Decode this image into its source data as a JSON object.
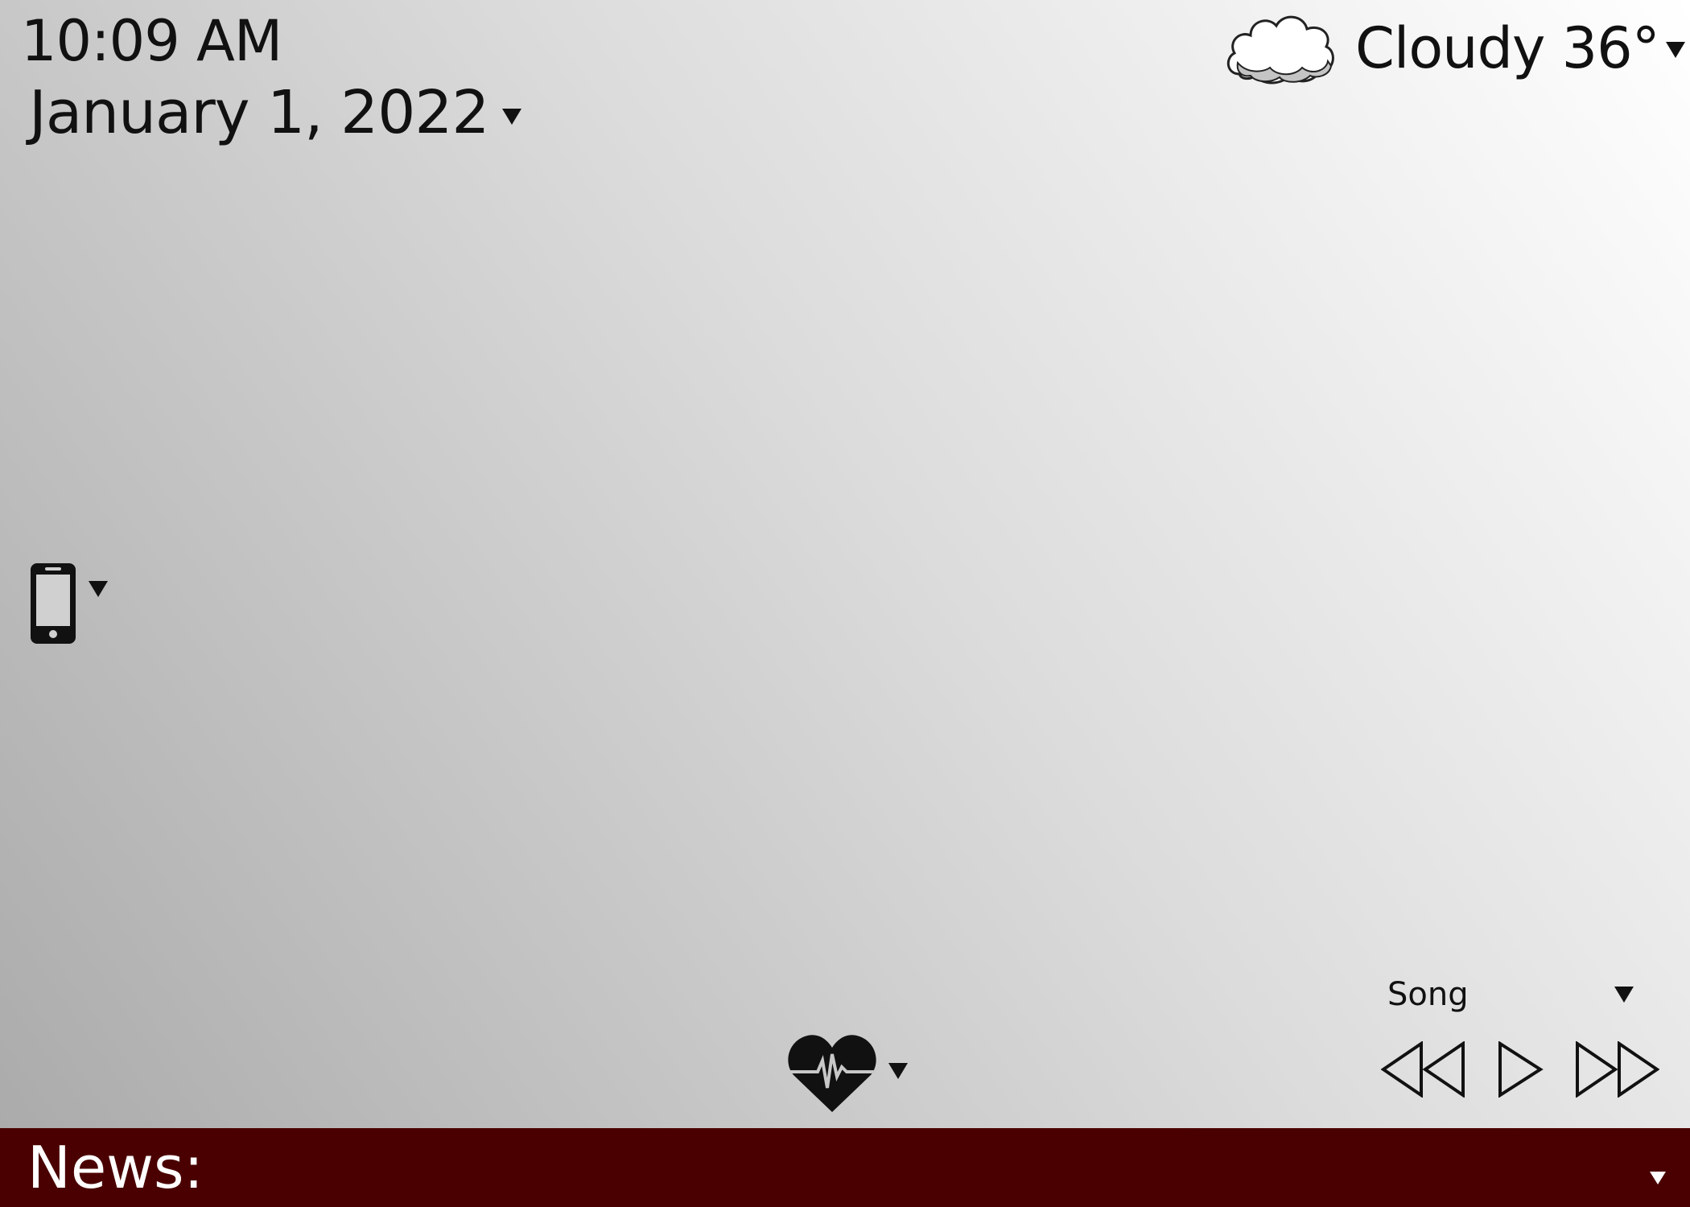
{
  "clock": {
    "time": "10:09 AM",
    "date": "January 1, 2022"
  },
  "weather": {
    "label": "Cloudy 36°",
    "icon": "cloud-icon"
  },
  "phone": {
    "icon": "phone-icon"
  },
  "health": {
    "icon": "heart-pulse-icon"
  },
  "music": {
    "song": "Song",
    "controls": [
      "rewind-icon",
      "play-icon",
      "fast-forward-icon"
    ]
  },
  "news": {
    "label": "News:"
  },
  "colors": {
    "news_bar": "#4a0000",
    "text": "#111111"
  }
}
